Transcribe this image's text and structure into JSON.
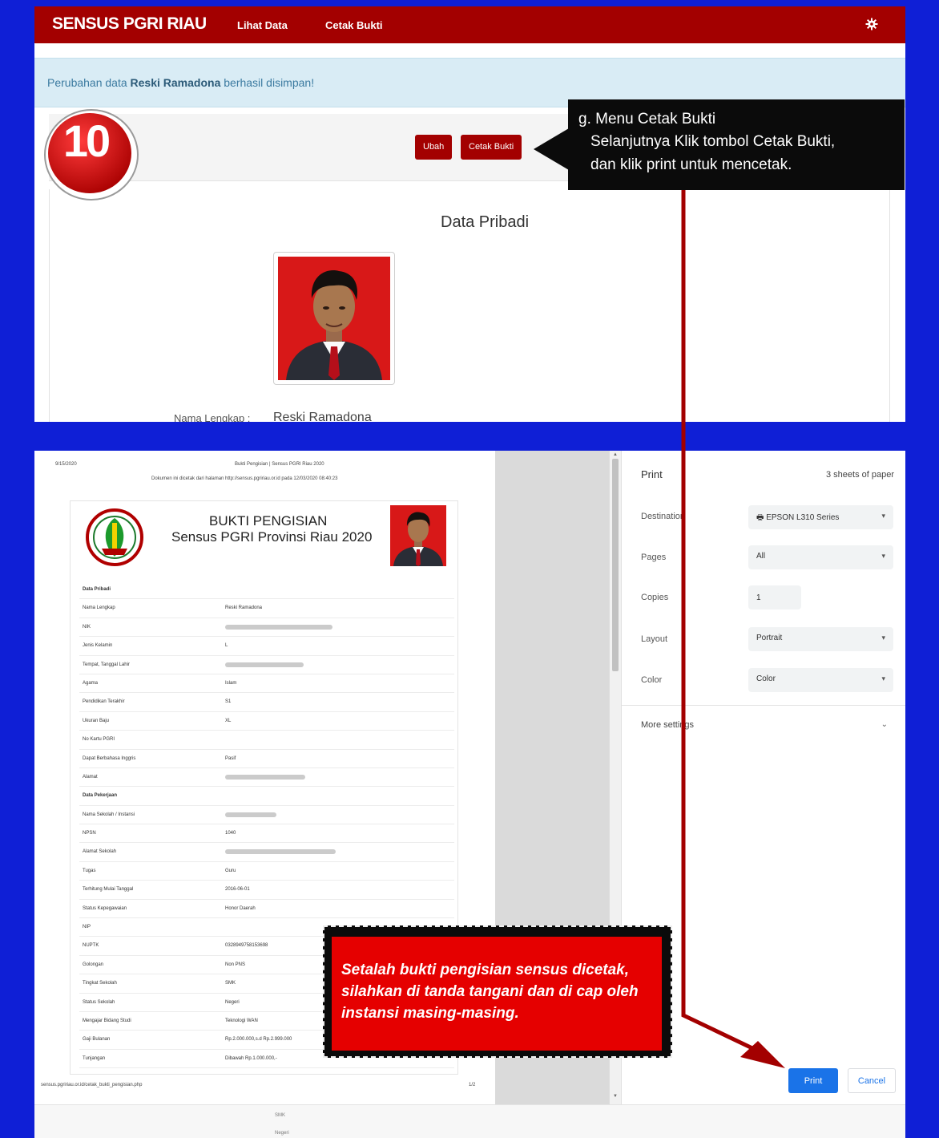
{
  "navbar": {
    "brand": "SENSUS PGRI RIAU",
    "links": [
      "Lihat Data",
      "Cetak Bukti"
    ],
    "settings_icon": "gear-icon"
  },
  "alert": {
    "prefix": "Perubahan data ",
    "name": "Reski Ramadona",
    "suffix": " berhasil disimpan!"
  },
  "step_badge": "10",
  "toolbar": {
    "edit_label": "Ubah",
    "print_label": "Cetak Bukti"
  },
  "callout": {
    "line1": "g. Menu Cetak Bukti",
    "line2": "Selanjutnya Klik tombol Cetak Bukti,",
    "line3": "dan klik print untuk mencetak."
  },
  "profile": {
    "title": "Data Pribadi",
    "name_label": "Nama Lengkap :",
    "name_value": "Reski Ramadona"
  },
  "preview": {
    "header_date": "9/15/2020",
    "header_title": "Bukti Pengisian | Sensus PGRI Riau 2020",
    "header_note": "Dokumen ini dicetak dari halaman http://sensus.pgririau.or.id pada 12/03/2020 08:40:23",
    "doc_title": "BUKTI PENGISIAN",
    "doc_subtitle": "Sensus PGRI Provinsi Riau 2020",
    "rows": [
      {
        "label": "Data Pribadi",
        "value": "",
        "section": true
      },
      {
        "label": "Nama Lengkap",
        "value": "Reski Ramadona"
      },
      {
        "label": "NIK",
        "value": ""
      },
      {
        "label": "Jenis Kelamin",
        "value": "L"
      },
      {
        "label": "Tempat, Tanggal Lahir",
        "value": ""
      },
      {
        "label": "Agama",
        "value": "Islam"
      },
      {
        "label": "Pendidikan Terakhir",
        "value": "S1"
      },
      {
        "label": "Ukuran Baju",
        "value": "XL"
      },
      {
        "label": "No Kartu PGRI",
        "value": ""
      },
      {
        "label": "Dapat Berbahasa Inggris",
        "value": "Pasif"
      },
      {
        "label": "Alamat",
        "value": ""
      },
      {
        "label": "Data Pekerjaan",
        "value": "",
        "section": true
      },
      {
        "label": "Nama Sekolah / Instansi",
        "value": ""
      },
      {
        "label": "NPSN",
        "value": "1040"
      },
      {
        "label": "Alamat Sekolah",
        "value": ""
      },
      {
        "label": "Tugas",
        "value": "Guru"
      },
      {
        "label": "Terhitung Mulai Tanggal",
        "value": "2016-06-01"
      },
      {
        "label": "Status Kepegawaian",
        "value": "Honor Daerah"
      },
      {
        "label": "NIP",
        "value": ""
      },
      {
        "label": "NUPTK",
        "value": "0328949758153698"
      },
      {
        "label": "Golongan",
        "value": "Non PNS"
      },
      {
        "label": "Tingkat Sekolah",
        "value": "SMK"
      },
      {
        "label": "Status Sekolah",
        "value": "Negeri"
      },
      {
        "label": "Mengajar Bidang Studi",
        "value": "Teknologi WAN"
      },
      {
        "label": "Gaji Bulanan",
        "value": "Rp.2.000.000,s.d Rp.2.999.000"
      },
      {
        "label": "Tunjangan",
        "value": "Dibawah Rp.1.000.000,-"
      }
    ],
    "footer_url": "sensus.pgririau.or.id/cetak_bukti_pengisian.php",
    "footer_page": "1/2"
  },
  "print_dialog": {
    "title": "Print",
    "sheets": "3 sheets of paper",
    "destination_label": "Destination",
    "destination_value": "EPSON L310 Series",
    "pages_label": "Pages",
    "pages_value": "All",
    "copies_label": "Copies",
    "copies_value": "1",
    "layout_label": "Layout",
    "layout_value": "Portrait",
    "color_label": "Color",
    "color_value": "Color",
    "more_settings": "More settings",
    "print_button": "Print",
    "cancel_button": "Cancel"
  },
  "bottom_strip": {
    "line1": "SMK",
    "line2": "Negeri"
  },
  "note": "Setalah bukti pengisian sensus dicetak, silahkan di tanda tangani dan di cap oleh instansi masing-masing.",
  "colors": {
    "background": "#0f1fd6",
    "navbar": "#a30000",
    "alert_bg": "#d9ecf5",
    "callout": "#0b0b0b",
    "note_red": "#e50000",
    "arrow": "#a30000",
    "print_blue": "#1a73e8"
  }
}
